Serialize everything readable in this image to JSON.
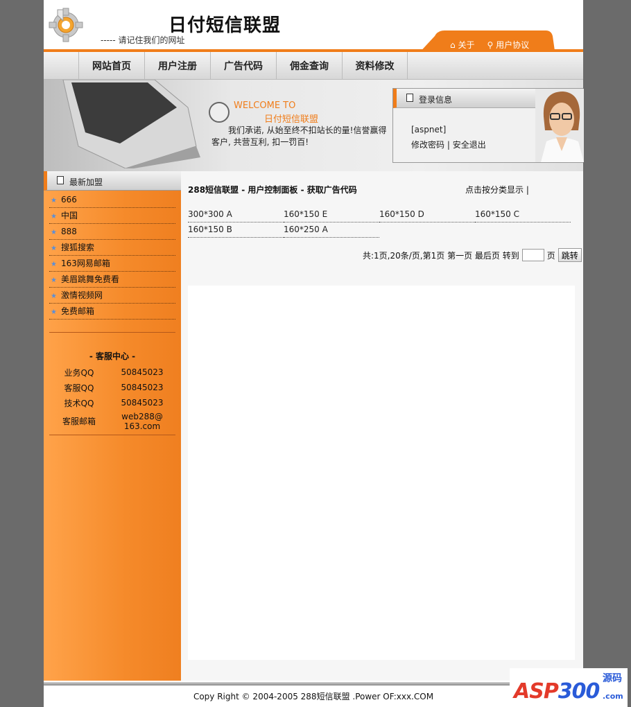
{
  "header": {
    "site_title": "日付短信联盟",
    "slogan": "----- 请记住我们的网址",
    "links": {
      "about": "关于",
      "agreement": "用户协议"
    }
  },
  "nav": {
    "items": [
      "网站首页",
      "用户注册",
      "广告代码",
      "佣金查询",
      "资料修改"
    ]
  },
  "banner": {
    "welcome_en": "WELCOME TO",
    "welcome_cn": "日付短信联盟",
    "text": "我们承诺, 从始至终不扣站长的量!信誉赢得客户, 共营互利, 扣一罚百!"
  },
  "login": {
    "title": "登录信息",
    "user": "[aspnet]",
    "change_password": "修改密码",
    "separator": "|",
    "logout": "安全退出"
  },
  "sidebar": {
    "title": "最新加盟",
    "items": [
      "666",
      "中国",
      "888",
      "搜狐搜索",
      "163网易邮箱",
      "美眉跳舞免费看",
      "激情视频网",
      "免费邮箱"
    ],
    "service": {
      "title": "- 客服中心 -",
      "rows": [
        {
          "label": "业务QQ",
          "value": "50845023"
        },
        {
          "label": "客服QQ",
          "value": "50845023"
        },
        {
          "label": "技术QQ",
          "value": "50845023"
        },
        {
          "label": "客服邮箱",
          "value": "web288@ 163.com"
        }
      ]
    }
  },
  "main": {
    "breadcrumb": "288短信联盟 - 用户控制面板 - 获取广告代码",
    "sort_link": "点击按分类显示 |",
    "ad_sizes": [
      [
        "300*300 A",
        "160*150 E",
        "160*150 D",
        "160*150 C"
      ],
      [
        "160*150 B",
        "160*250 A"
      ]
    ],
    "pager": {
      "info": "共:1页,20条/页,第1页 第一页 最后页 转到",
      "page_unit": "页",
      "jump_label": "跳转",
      "page_input": ""
    }
  },
  "footer": {
    "text": "Copy Right © 2004-2005 288短信联盟 .Power OF:xxx.COM"
  },
  "watermark": {
    "asp": "ASP",
    "num": "300",
    "src": "源码",
    "com": ".com"
  },
  "colors": {
    "accent": "#f07d1a",
    "sidebar": "#f58a2a",
    "frame": "#6b6b6b"
  }
}
